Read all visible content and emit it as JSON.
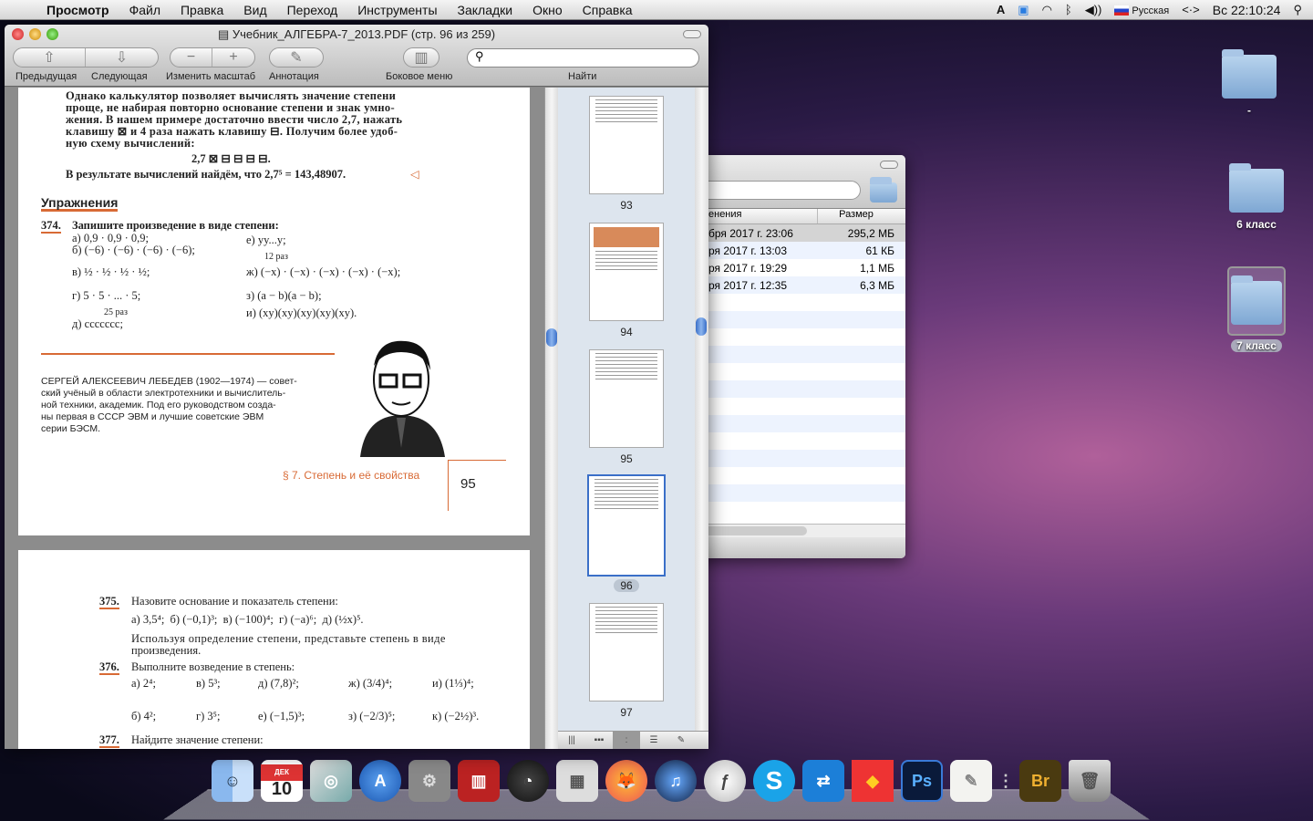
{
  "menubar": {
    "app": "Просмотр",
    "items": [
      "Файл",
      "Правка",
      "Вид",
      "Переход",
      "Инструменты",
      "Закладки",
      "Окно",
      "Справка"
    ],
    "input_source": "Русская",
    "clock": "Вс 22:10:24"
  },
  "window": {
    "title": "Учебник_АЛГЕБРА-7_2013.PDF (стр. 96 из 259)",
    "toolbar": {
      "prev": "Предыдущая",
      "next": "Следующая",
      "zoom": "Изменить масштаб",
      "annotate": "Аннотация",
      "sidebar": "Боковое меню",
      "find": "Найти",
      "search_value": ""
    }
  },
  "page1": {
    "lines": [
      "Однако калькулятор позволяет вычислять значение степени",
      "проще, не набирая повторно основание степени и знак умно-",
      "жения. В нашем примере достаточно ввести число 2,7, нажать",
      "клавишу ⊠ и 4 раза нажать клавишу ⊟. Получим более удоб-",
      "ную схему вычислений:"
    ],
    "scheme": "2,7 ⊠ ⊟ ⊟ ⊟ ⊟.",
    "result": "В результате вычислений найдём, что 2,7⁵ = 143,48907.",
    "result_mark": "◁",
    "exercises_title": "Упражнения",
    "ex374": {
      "num": "374.",
      "text": "Запишите произведение в виде степени:",
      "items": [
        "а) 0,9 · 0,9 · 0,9;",
        "б) (−6) · (−6) · (−6) · (−6);",
        "в) ½ · ½ · ½ · ½;",
        "г) 5 · 5 · ... · 5;",
        "25 раз",
        "д) ccccccc;",
        "е) yy...y;",
        "12 раз",
        "ж) (−x) · (−x) · (−x) · (−x) · (−x);",
        "з) (a − b)(a − b);",
        "и) (xy)(xy)(xy)(xy)(xy)."
      ]
    },
    "bio": [
      "СЕРГЕЙ АЛЕКСЕЕВИЧ ЛЕБЕДЕВ (1902—1974) — совет-",
      "ский учёный в области электротехники и вычислитель-",
      "ной техники, академик. Под его руководством созда-",
      "ны первая в СССР ЭВМ и лучшие советские ЭВМ",
      "серии БЭСМ."
    ],
    "section": "§ 7. Степень и её свойства",
    "page_number": "95"
  },
  "page2": {
    "ex375": {
      "num": "375.",
      "text": "Назовите основание и показатель степени:",
      "items": "а) 3,5⁴;  б) (−0,1)³;  в) (−100)⁴;  г) (−a)⁶;  д) (½x)⁵.",
      "extra": [
        "Используя определение степени, представьте степень в виде",
        "произведения."
      ]
    },
    "ex376": {
      "num": "376.",
      "text": "Выполните возведение в степень:",
      "row1": [
        "а) 2⁴;",
        "в) 5³;",
        "д) (7,8)²;",
        "ж) (3/4)⁴;",
        "и) (1⅓)⁴;"
      ],
      "row2": [
        "б) 4²;",
        "г) 3⁵;",
        "е) (−1,5)³;",
        "з) (−2/3)⁵;",
        "к) (−2½)³."
      ]
    },
    "ex377": {
      "num": "377.",
      "text": "Найдите значение степени:"
    }
  },
  "thumbnails": [
    {
      "label": "93"
    },
    {
      "label": "94"
    },
    {
      "label": "95"
    },
    {
      "label": "96",
      "selected": true
    },
    {
      "label": "97"
    }
  ],
  "finder": {
    "columns": [
      "енения",
      "Размер"
    ],
    "rows": [
      {
        "date": "бря 2017 г. 23:06",
        "size": "295,2 МБ"
      },
      {
        "date": "ря 2017 г. 13:03",
        "size": "61 КБ"
      },
      {
        "date": "ря 2017 г. 19:29",
        "size": "1,1 МБ"
      },
      {
        "date": "ря 2017 г. 12:35",
        "size": "6,3 МБ"
      }
    ]
  },
  "desktop": [
    {
      "label": "-"
    },
    {
      "label": "6 класс"
    },
    {
      "label": "7 класс",
      "selected": true
    }
  ],
  "dock": {
    "calendar_month": "ДЕК",
    "calendar_day": "10",
    "bridge": "Br",
    "photoshop": "Ps"
  }
}
